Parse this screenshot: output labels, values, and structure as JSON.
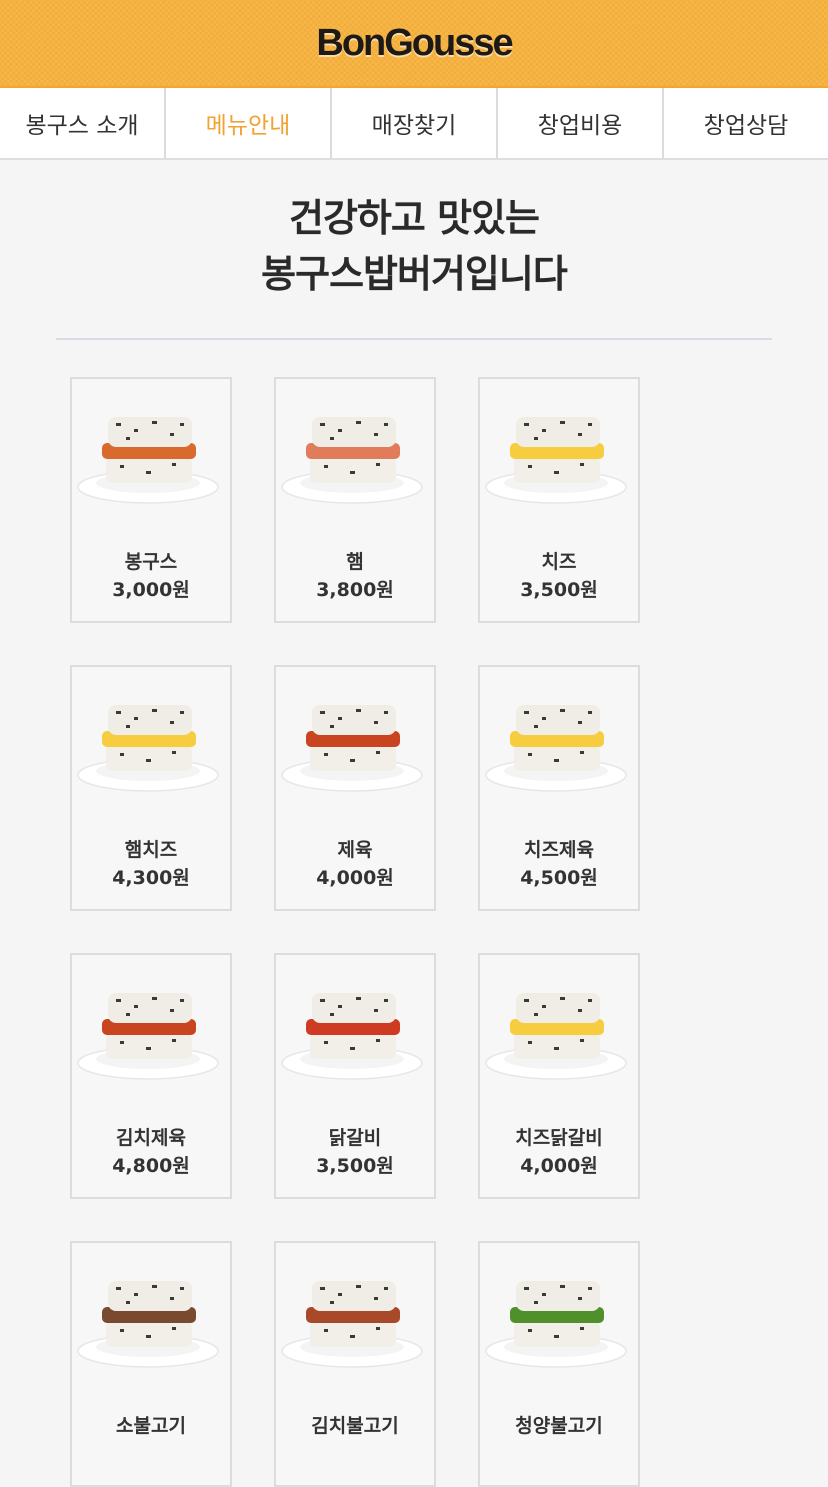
{
  "header": {
    "logo": "BonGousse"
  },
  "nav": {
    "items": [
      {
        "label": "봉구스 소개",
        "active": false
      },
      {
        "label": "메뉴안내",
        "active": true
      },
      {
        "label": "매장찾기",
        "active": false
      },
      {
        "label": "창업비용",
        "active": false
      },
      {
        "label": "창업상담",
        "active": false
      }
    ]
  },
  "headline": {
    "line1": "건강하고 맛있는",
    "line2": "봉구스밥버거입니다"
  },
  "menu": [
    {
      "name": "봉구스",
      "price": "3,000원",
      "filling": "#d96a2e"
    },
    {
      "name": "햄",
      "price": "3,800원",
      "filling": "#e07c5a"
    },
    {
      "name": "치즈",
      "price": "3,500원",
      "filling": "#f6cd3e"
    },
    {
      "name": "햄치즈",
      "price": "4,300원",
      "filling": "#f6cd3e"
    },
    {
      "name": "제육",
      "price": "4,000원",
      "filling": "#c8451f"
    },
    {
      "name": "치즈제육",
      "price": "4,500원",
      "filling": "#f6cd3e"
    },
    {
      "name": "김치제육",
      "price": "4,800원",
      "filling": "#c8451f"
    },
    {
      "name": "닭갈비",
      "price": "3,500원",
      "filling": "#cf3b22"
    },
    {
      "name": "치즈닭갈비",
      "price": "4,000원",
      "filling": "#f6cd3e"
    },
    {
      "name": "소불고기",
      "price": "",
      "filling": "#7a4a30"
    },
    {
      "name": "김치불고기",
      "price": "",
      "filling": "#a84a2a"
    },
    {
      "name": "청양불고기",
      "price": "",
      "filling": "#4f8f2c"
    }
  ]
}
